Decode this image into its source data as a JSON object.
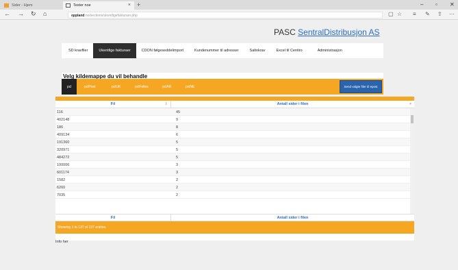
{
  "browser": {
    "tabs": [
      {
        "label": "Sider - Hjem"
      },
      {
        "label": "Tester noe"
      }
    ],
    "url_host": "oppland",
    "url_path": ".no/sections/ukentligefakturaer.php"
  },
  "page": {
    "brand_prefix": "PASC",
    "brand_link": "SentralDistribusjon AS",
    "menu": [
      {
        "label": "SD kravfiler"
      },
      {
        "label": "Ukentlige fakturaer"
      },
      {
        "label": "CDON følgeseddelimport"
      },
      {
        "label": "Kundenummer til adresser"
      },
      {
        "label": "Saltokrav"
      },
      {
        "label": "Excel til Centiro"
      },
      {
        "label": "Administrasjon"
      }
    ],
    "panel_title": "Velg kildemappe du vil behandle",
    "folders": [
      {
        "label": "pcl"
      },
      {
        "label": "pclPost"
      },
      {
        "label": "pclUK"
      },
      {
        "label": "pclFelles"
      },
      {
        "label": "pclAR"
      },
      {
        "label": "pclNE"
      }
    ],
    "send_button": "Send valgte filer til epost",
    "table": {
      "col1": "Fil",
      "col2": "Antall sider i filen",
      "rows": [
        [
          "116",
          "45"
        ],
        [
          "402148",
          "9"
        ],
        [
          "186",
          "8"
        ],
        [
          "409134",
          "6"
        ],
        [
          "191360",
          "5"
        ],
        [
          "320971",
          "5"
        ],
        [
          "484272",
          "5"
        ],
        [
          "100006",
          "3"
        ],
        [
          "601174",
          "3"
        ],
        [
          "1582",
          "2"
        ],
        [
          "6260",
          "2"
        ],
        [
          "7035",
          "2"
        ]
      ],
      "footer_text": "Showing 1 to 137 of 137 entries"
    },
    "info": "Info her"
  }
}
